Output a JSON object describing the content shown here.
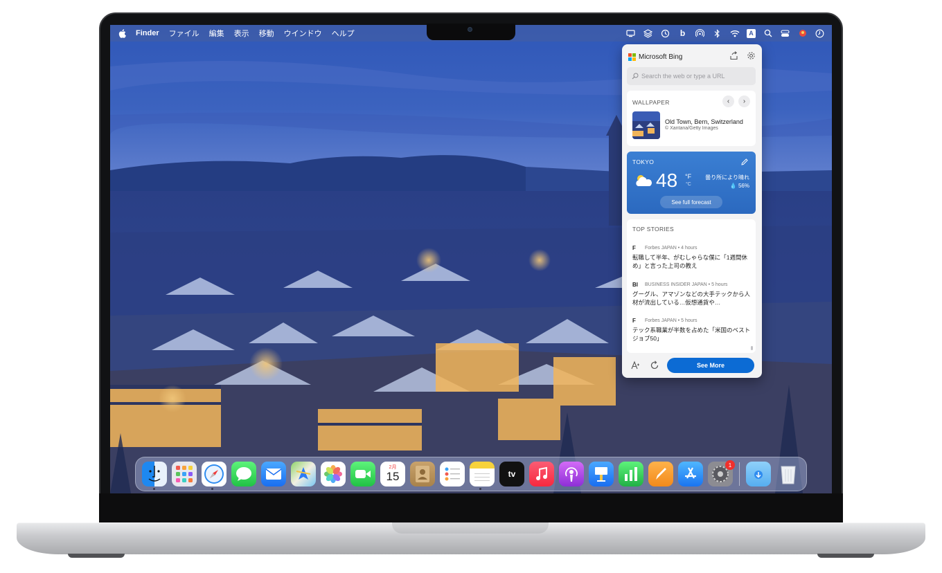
{
  "menubar": {
    "app_name": "Finder",
    "menus": [
      "ファイル",
      "編集",
      "表示",
      "移動",
      "ウインドウ",
      "ヘルプ"
    ],
    "status_icons": [
      "display-icon",
      "layers-icon",
      "time-machine-icon",
      "bing-icon",
      "airdrop-icon",
      "bluetooth-icon",
      "wifi-icon",
      "input-source-icon",
      "search-icon",
      "control-center-icon",
      "user-icon",
      "clock-icon"
    ],
    "input_source_label": "A",
    "bing_label": "b"
  },
  "bing": {
    "title": "Microsoft Bing",
    "search_placeholder": "Search the web or type a URL",
    "wallpaper": {
      "label": "WALLPAPER",
      "prev": "‹",
      "next": "›",
      "title": "Old Town, Bern, Switzerland",
      "credit": "© Xantana/Getty Images"
    },
    "weather": {
      "city": "TOKYO",
      "temp": "48",
      "unit_f": "°F",
      "unit_c": "°C",
      "condition": "曇り所により晴れ",
      "humidity": "💧 56%",
      "forecast_button": "See full forecast"
    },
    "stories": {
      "label": "TOP STORIES",
      "items": [
        {
          "logo": "F",
          "source": "Forbes JAPAN • 4 hours",
          "title": "転職して半年、がむしゃらな僕に「1週間休め」と言った上司の教え"
        },
        {
          "logo": "BI",
          "source": "BUSINESS INSIDER JAPAN • 5 hours",
          "title": "グーグル、アマゾンなどの大手テックから人材が流出している…仮想通貨や…"
        },
        {
          "logo": "F",
          "source": "Forbes JAPAN • 5 hours",
          "title": "テック系職業が半数を占めた「米国のベストジョブ50」"
        }
      ]
    },
    "see_more": "See More"
  },
  "dock": {
    "apps": [
      "finder",
      "launchpad",
      "safari",
      "messages",
      "mail",
      "maps",
      "photos",
      "facetime",
      "calendar",
      "contacts",
      "reminders",
      "notes",
      "tv",
      "music",
      "podcasts",
      "keynote",
      "numbers",
      "pages",
      "app-store",
      "system-preferences"
    ],
    "calendar_month": "2月",
    "calendar_day": "15",
    "tv_label": "tv",
    "system_prefs_badge": "1"
  },
  "colors": {
    "accent": "#0c6bd4",
    "weather_bg": "#2f6fc6",
    "badge": "#f0302c"
  }
}
